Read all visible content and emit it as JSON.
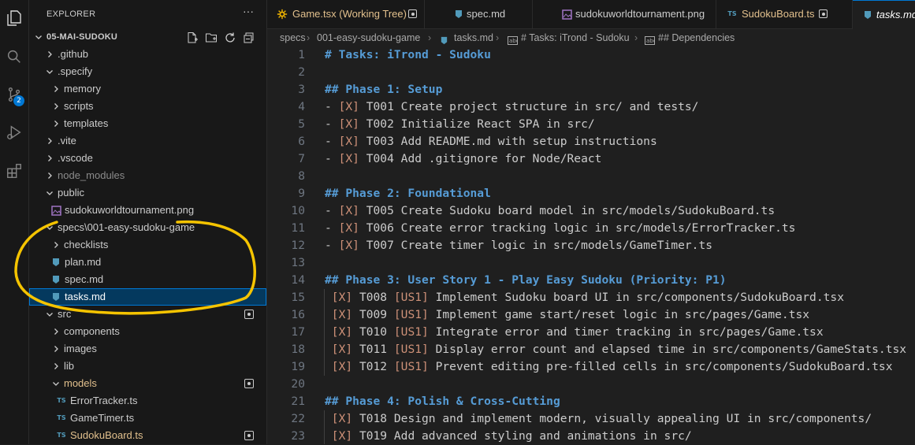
{
  "explorer": {
    "title": "EXPLORER",
    "more_label": "···",
    "root_label": "05-MAI-SUDOKU",
    "rows": [
      {
        "label": ".github",
        "kind": "folder"
      },
      {
        "label": ".specify",
        "kind": "folder"
      },
      {
        "label": "memory",
        "kind": "folder"
      },
      {
        "label": "scripts",
        "kind": "folder"
      },
      {
        "label": "templates",
        "kind": "folder"
      },
      {
        "label": ".vite",
        "kind": "folder"
      },
      {
        "label": ".vscode",
        "kind": "folder"
      },
      {
        "label": "node_modules",
        "kind": "folder"
      },
      {
        "label": "public",
        "kind": "folder"
      },
      {
        "label": "sudokuworldtournament.png",
        "kind": "image"
      },
      {
        "label": "specs\\001-easy-sudoku-game",
        "kind": "folder"
      },
      {
        "label": "checklists",
        "kind": "folder"
      },
      {
        "label": "plan.md",
        "kind": "markdown"
      },
      {
        "label": "spec.md",
        "kind": "markdown"
      },
      {
        "label": "tasks.md",
        "kind": "markdown"
      },
      {
        "label": "src",
        "kind": "folder"
      },
      {
        "label": "components",
        "kind": "folder"
      },
      {
        "label": "images",
        "kind": "folder"
      },
      {
        "label": "lib",
        "kind": "folder"
      },
      {
        "label": "models",
        "kind": "folder"
      },
      {
        "label": "ErrorTracker.ts",
        "kind": "ts"
      },
      {
        "label": "GameTimer.ts",
        "kind": "ts"
      },
      {
        "label": "SudokuBoard.ts",
        "kind": "ts"
      }
    ],
    "ts_badge": "TS"
  },
  "scm_badge": "2",
  "tabs": [
    {
      "label": "Game.tsx (Working Tree)"
    },
    {
      "label": "spec.md"
    },
    {
      "label": "sudokuworldtournament.png"
    },
    {
      "label": "SudokuBoard.ts"
    },
    {
      "label": "tasks.md"
    }
  ],
  "breadcrumb": [
    "specs",
    "001-easy-sudoku-game",
    "tasks.md",
    "# Tasks: iTrond - Sudoku",
    "## Dependencies"
  ],
  "editor": {
    "lines": [
      {
        "n": "1",
        "parts": [
          {
            "t": "# Tasks: iTrond - Sudoku",
            "c": "h"
          }
        ]
      },
      {
        "n": "2",
        "parts": []
      },
      {
        "n": "3",
        "parts": [
          {
            "t": "## Phase 1: Setup",
            "c": "h"
          }
        ]
      },
      {
        "n": "4",
        "parts": [
          {
            "t": "- ",
            "c": ""
          },
          {
            "t": "[X]",
            "c": "x"
          },
          {
            "t": " T001 Create project structure in src/ and tests/",
            "c": ""
          }
        ]
      },
      {
        "n": "5",
        "parts": [
          {
            "t": "- ",
            "c": ""
          },
          {
            "t": "[X]",
            "c": "x"
          },
          {
            "t": " T002 Initialize React SPA in src/",
            "c": ""
          }
        ]
      },
      {
        "n": "6",
        "parts": [
          {
            "t": "- ",
            "c": ""
          },
          {
            "t": "[X]",
            "c": "x"
          },
          {
            "t": " T003 Add README.md with setup instructions",
            "c": ""
          }
        ]
      },
      {
        "n": "7",
        "parts": [
          {
            "t": "- ",
            "c": ""
          },
          {
            "t": "[X]",
            "c": "x"
          },
          {
            "t": " T004 Add .gitignore for Node/React",
            "c": ""
          }
        ]
      },
      {
        "n": "8",
        "parts": []
      },
      {
        "n": "9",
        "parts": [
          {
            "t": "## Phase 2: Foundational",
            "c": "h"
          }
        ]
      },
      {
        "n": "10",
        "parts": [
          {
            "t": "- ",
            "c": ""
          },
          {
            "t": "[X]",
            "c": "x"
          },
          {
            "t": " T005 Create Sudoku board model in src/models/SudokuBoard.ts",
            "c": ""
          }
        ]
      },
      {
        "n": "11",
        "parts": [
          {
            "t": "- ",
            "c": ""
          },
          {
            "t": "[X]",
            "c": "x"
          },
          {
            "t": " T006 Create error tracking logic in src/models/ErrorTracker.ts",
            "c": ""
          }
        ]
      },
      {
        "n": "12",
        "parts": [
          {
            "t": "- ",
            "c": ""
          },
          {
            "t": "[X]",
            "c": "x"
          },
          {
            "t": " T007 Create timer logic in src/models/GameTimer.ts",
            "c": ""
          }
        ]
      },
      {
        "n": "13",
        "parts": []
      },
      {
        "n": "14",
        "parts": [
          {
            "t": "## Phase 3: User Story 1 - Play Easy Sudoku (Priority: P1)",
            "c": "h"
          }
        ]
      },
      {
        "n": "15",
        "parts": [
          {
            "t": " ",
            "c": ""
          },
          {
            "t": "[X]",
            "c": "x"
          },
          {
            "t": " T008 ",
            "c": ""
          },
          {
            "t": "[US1]",
            "c": "us"
          },
          {
            "t": " Implement Sudoku board UI in src/components/SudokuBoard.tsx",
            "c": ""
          }
        ]
      },
      {
        "n": "16",
        "parts": [
          {
            "t": " ",
            "c": ""
          },
          {
            "t": "[X]",
            "c": "x"
          },
          {
            "t": " T009 ",
            "c": ""
          },
          {
            "t": "[US1]",
            "c": "us"
          },
          {
            "t": " Implement game start/reset logic in src/pages/Game.tsx",
            "c": ""
          }
        ]
      },
      {
        "n": "17",
        "parts": [
          {
            "t": " ",
            "c": ""
          },
          {
            "t": "[X]",
            "c": "x"
          },
          {
            "t": " T010 ",
            "c": ""
          },
          {
            "t": "[US1]",
            "c": "us"
          },
          {
            "t": " Integrate error and timer tracking in src/pages/Game.tsx",
            "c": ""
          }
        ]
      },
      {
        "n": "18",
        "parts": [
          {
            "t": " ",
            "c": ""
          },
          {
            "t": "[X]",
            "c": "x"
          },
          {
            "t": " T011 ",
            "c": ""
          },
          {
            "t": "[US1]",
            "c": "us"
          },
          {
            "t": " Display error count and elapsed time in src/components/GameStats.tsx",
            "c": ""
          }
        ]
      },
      {
        "n": "19",
        "parts": [
          {
            "t": " ",
            "c": ""
          },
          {
            "t": "[X]",
            "c": "x"
          },
          {
            "t": " T012 ",
            "c": ""
          },
          {
            "t": "[US1]",
            "c": "us"
          },
          {
            "t": " Prevent editing pre-filled cells in src/components/SudokuBoard.tsx",
            "c": ""
          }
        ]
      },
      {
        "n": "20",
        "parts": []
      },
      {
        "n": "21",
        "parts": [
          {
            "t": "## Phase 4: Polish & Cross-Cutting",
            "c": "h"
          }
        ]
      },
      {
        "n": "22",
        "parts": [
          {
            "t": " ",
            "c": ""
          },
          {
            "t": "[X]",
            "c": "x"
          },
          {
            "t": " T018 Design and implement modern, visually appealing UI in src/components/",
            "c": ""
          }
        ]
      },
      {
        "n": "23",
        "parts": [
          {
            "t": " ",
            "c": ""
          },
          {
            "t": "[X]",
            "c": "x"
          },
          {
            "t": " T019 Add advanced styling and animations in src/",
            "c": ""
          }
        ]
      }
    ]
  },
  "colors": {
    "accent": "#0078d4",
    "highlight_annotation": "#f5c400",
    "modified": "#e2c08d",
    "markdown_heading": "#569cd6",
    "checkbox": "#ce9178"
  }
}
